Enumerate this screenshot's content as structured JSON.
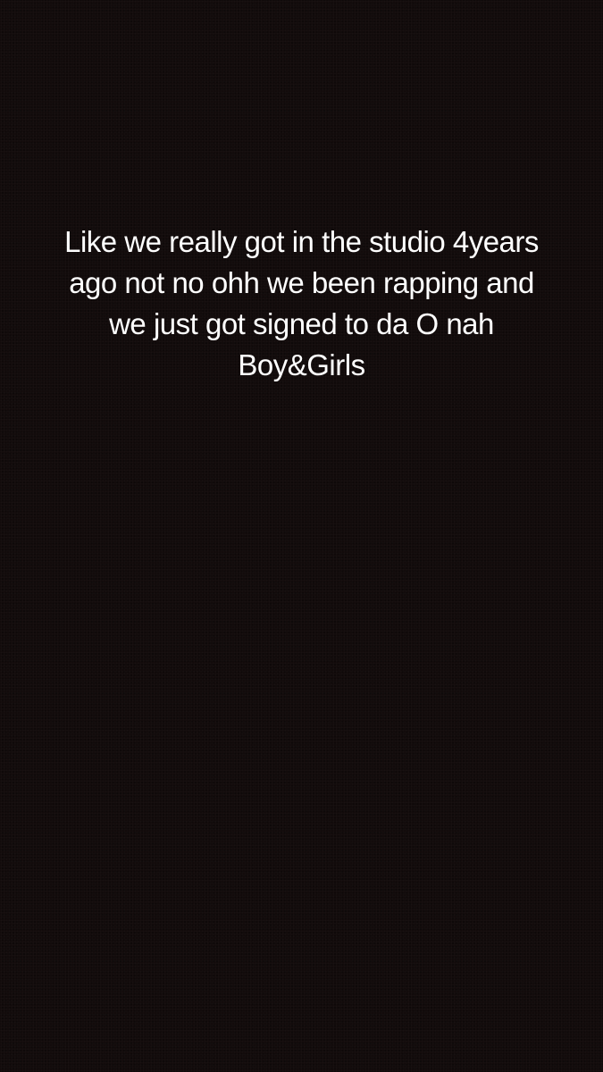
{
  "story": {
    "background_color": "#120b0b",
    "text_color": "#ffffff",
    "caption_lines": [
      "Like we really got in the studio 4years",
      "ago not no ohh we been rapping and",
      "we just got signed to da O nah",
      "Boy&Girls"
    ]
  }
}
